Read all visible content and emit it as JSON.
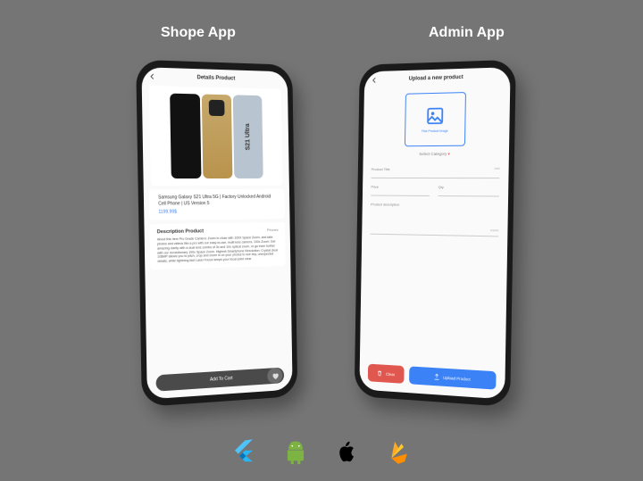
{
  "titles": {
    "left": "Shope App",
    "right": "Admin App"
  },
  "shop": {
    "header": "Details Product",
    "product_name": "Samsung Galaxy S21 Ultra 5G | Factory Unlocked Android Cell Phone | US Version 5",
    "price": "1199.99$",
    "desc_heading": "Description Product",
    "category_tag": "Phones",
    "description": "About this item\nPro Grade Camera: Zoom in close with 100X Space Zoom, and take photos and videos like a pro with our easy-to-use, multi-lens camera.\n100x Zoom: Get amazing clarity with a dual lens combo of 3x and 10x optical zoom, or go even further with our revolutionary 100x Space Zoom.\nHighest Smartphone Resolution: Crystal clear 108MP allows you to pitch, crop and zoom in on your photos to see tiny, unexpected details, while lightning-fast Laser Focus keeps your focal point clear",
    "add_to_cart": "Add To Cart"
  },
  "admin": {
    "header": "Upload a new product",
    "pick_image": "Pick Product Image",
    "select_category": "Select Category",
    "fields": {
      "title": "Product Title",
      "title_char": "0/80",
      "price": "Price",
      "qty": "Qty",
      "desc": "Product description",
      "desc_char": "0/1000"
    },
    "buttons": {
      "clear": "Clear",
      "upload": "Upload Product"
    }
  },
  "tech_icons": [
    "flutter",
    "android",
    "apple",
    "firebase"
  ]
}
